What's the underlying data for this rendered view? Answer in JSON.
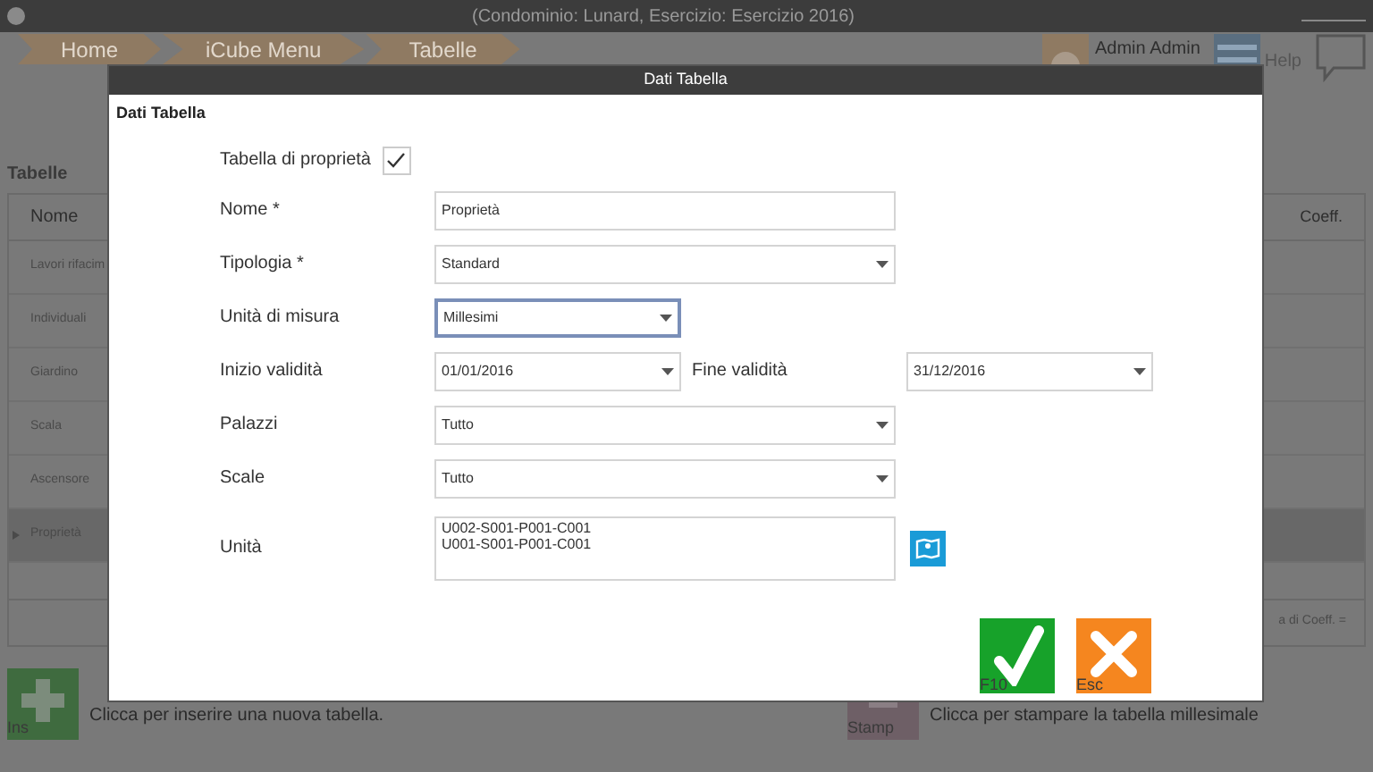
{
  "window": {
    "title": "(Condominio: Lunard, Esercizio: Esercizio 2016)"
  },
  "breadcrumb": [
    "Home",
    "iCube Menu",
    "Tabelle"
  ],
  "user": {
    "name": "Admin Admin"
  },
  "help": {
    "label": "Help"
  },
  "tables": {
    "title": "Tabelle",
    "columns": [
      "Nome",
      "Coeff."
    ],
    "rows": [
      {
        "name": "Lavori rifacim",
        "selected": false
      },
      {
        "name": "Individuali",
        "selected": false
      },
      {
        "name": "Giardino",
        "selected": false
      },
      {
        "name": "Scala",
        "selected": false
      },
      {
        "name": "Ascensore",
        "selected": false
      },
      {
        "name": "Proprietà",
        "selected": true
      }
    ],
    "footer": "a di Coeff. ="
  },
  "actions": [
    {
      "key": "Ins",
      "kind": "insert",
      "text": "Clicca per inserire una nuova tabella."
    },
    {
      "key": "Stamp",
      "kind": "print",
      "text": "Clicca per stampare la tabella millesimale"
    }
  ],
  "dialog": {
    "title": "Dati Tabella",
    "heading": "Dati Tabella",
    "checkbox": {
      "label": "Tabella di proprietà",
      "checked": true
    },
    "fields": [
      {
        "label": "Nome *",
        "kind": "text",
        "value": "Proprietà",
        "focused": false
      },
      {
        "label": "Tipologia *",
        "kind": "select",
        "value": "Standard",
        "focused": false
      },
      {
        "label": "Unità di misura",
        "kind": "select-short",
        "value": "Millesimi",
        "focused": true
      },
      {
        "label": "Inizio validità",
        "kind": "date-range",
        "value": "01/01/2016",
        "focused": false,
        "end_label": "Fine validità",
        "end_value": "31/12/2016"
      },
      {
        "label": "Palazzi",
        "kind": "select",
        "value": "Tutto",
        "focused": false
      },
      {
        "label": "Scale",
        "kind": "select",
        "value": "Tutto",
        "focused": false
      },
      {
        "label": "Unità",
        "kind": "textarea",
        "lines": [
          "U002-S001-P001-C001",
          "U001-S001-P001-C001"
        ],
        "focused": false
      }
    ],
    "buttons": [
      {
        "key": "F10",
        "kind": "ok"
      },
      {
        "key": "Esc",
        "kind": "cancel"
      }
    ]
  }
}
